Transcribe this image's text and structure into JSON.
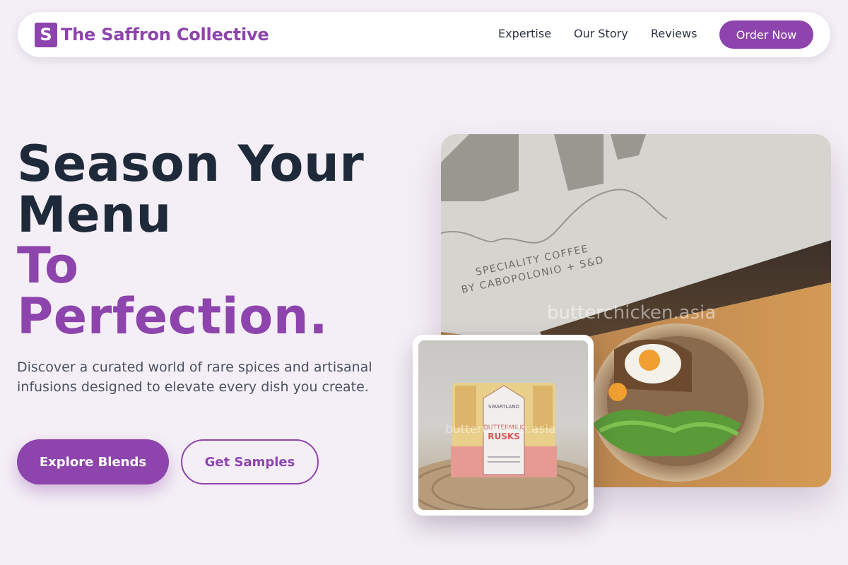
{
  "header": {
    "logo_letter": "S",
    "brand_name": "The Saffron Collective",
    "nav": [
      "Expertise",
      "Our Story",
      "Reviews"
    ],
    "cta_label": "Order Now"
  },
  "hero": {
    "headline_line1": "Season Your",
    "headline_line2": "Menu",
    "headline_line3": "To",
    "headline_line4": "Perfection.",
    "subtext": "Discover a curated world of rare spices and artisanal infusions designed to elevate every dish you create.",
    "primary_button": "Explore Blends",
    "secondary_button": "Get Samples"
  },
  "images": {
    "main_photo_watermark": "butterchicken.asia",
    "main_photo_sign_text": "SPECIALITY COFFEE BY CABOPOLONIO + S&D",
    "inset_watermark": "butterchicken.asia",
    "package_brand": "SWARTLAND",
    "package_label_line1": "BUTTERMILK",
    "package_label_line2": "RUSKS"
  },
  "colors": {
    "accent": "#8e44ad",
    "headline": "#1e2a3a",
    "background": "#f4eff6"
  }
}
